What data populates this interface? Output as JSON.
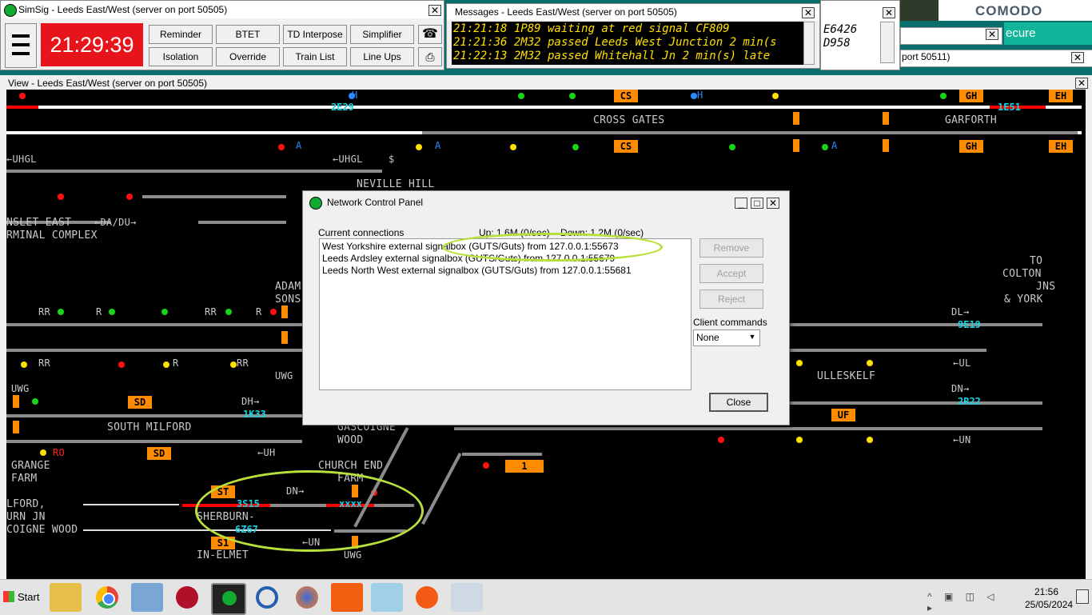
{
  "simsig_window": {
    "title": "SimSig - Leeds East/West (server on port 50505)",
    "clock": "21:29:39",
    "buttons": [
      "Reminder",
      "BTET",
      "TD Interpose",
      "Simplifier",
      "Isolation",
      "Override",
      "Train List",
      "Line Ups"
    ]
  },
  "messages_window": {
    "title": "Messages - Leeds East/West (server on port 50505)",
    "lines": [
      "21:21:18 1P89 waiting at red signal CF809",
      "21:21:36 2M32 passed Leeds West Junction 2 min(s",
      "21:22:13 2M32 passed Whitehall Jn 2 min(s) late"
    ],
    "background_fragments": [
      "E6426",
      "D958"
    ]
  },
  "background_windows": {
    "comodo": "COMODO",
    "secure": "ecure",
    "port_fragment": "port 50511)"
  },
  "view_window": {
    "title": "View - Leeds East/West (server on port 50505)"
  },
  "panel": {
    "places": {
      "cross_gates": "CROSS GATES",
      "garforth": "GARFORTH",
      "neville_hill": "NEVILLE HILL",
      "hunslet_east": "NSLET EAST",
      "terminal_complex": "RMINAL COMPLEX",
      "adam1": "ADAM",
      "adam2": "SONS",
      "to_colton1": "TO",
      "to_colton2": "COLTON",
      "to_colton3": "JNS",
      "to_colton4": "& YORK",
      "ulleskelf": "ULLESKELF",
      "south_milford": "SOUTH MILFORD",
      "gascoigne1": "GASCOIGNE",
      "gascoigne2": "WOOD",
      "grange1": "GRANGE",
      "grange2": "FARM",
      "church_end1": "CHURCH END",
      "church_end2": "FARM",
      "milford1": "LFORD,",
      "milford2": "URN JN",
      "milford3": "COIGNE WOOD",
      "sherburn1": "SHERBURN-",
      "sherburn2": "IN-ELMET"
    },
    "arrows": {
      "uhgl1": "←UHGL",
      "uhgl2": "←UHGL",
      "dadu": "←DA/DU→",
      "dl": "DL→",
      "dh": "DH→",
      "dn1": "DN→",
      "dn2": "DN→",
      "un1": "←UN",
      "un2": "←UN",
      "ul": "←UL",
      "uh": "←UH",
      "dollar": "$"
    },
    "short_labels": {
      "rr1": "RR",
      "r1": "R",
      "rr2": "RR",
      "r2": "R",
      "rr3": "RR",
      "r3": "R",
      "rr4": "RR",
      "uwg1": "UWG",
      "uwg2": "UWG",
      "uwg3": "UWG",
      "ro": "RO",
      "ah1": "H",
      "ah2": "A",
      "ah3": "A",
      "ah4": "H",
      "ah5": "A"
    },
    "berths": {
      "b1": "2E29",
      "b2": "1E51",
      "b3": "9E19",
      "b4": "2R22",
      "b5": "1K33",
      "b6": "3S15",
      "b7": "6Z67",
      "b8": "xxxx"
    },
    "orange_boxes": {
      "cs1": "CS",
      "cs2": "CS",
      "gh1": "GH",
      "gh2": "GH",
      "eh1": "EH",
      "eh2": "EH",
      "sd1": "SD",
      "sd2": "SD",
      "uf": "UF",
      "st": "ST",
      "s1": "S1",
      "one": "1"
    }
  },
  "network_panel": {
    "title": "Network Control Panel",
    "connections_label": "Current connections",
    "stats": "Up: 1.6M (0/sec)    Down: 1.2M (0/sec)",
    "connections": [
      "West Yorkshire external signalbox (GUTS/Guts) from 127.0.0.1:55673",
      "Leeds Ardsley external signalbox (GUTS/Guts) from 127.0.0.1:55679",
      "Leeds North West external signalbox (GUTS/Guts) from 127.0.0.1:55681"
    ],
    "remove_label": "Remove",
    "accept_label": "Accept",
    "reject_label": "Reject",
    "client_commands_label": "Client commands",
    "client_commands_value": "None",
    "close_label": "Close"
  },
  "taskbar": {
    "start_label": "Start",
    "time": "21:56",
    "date": "25/05/2024"
  }
}
